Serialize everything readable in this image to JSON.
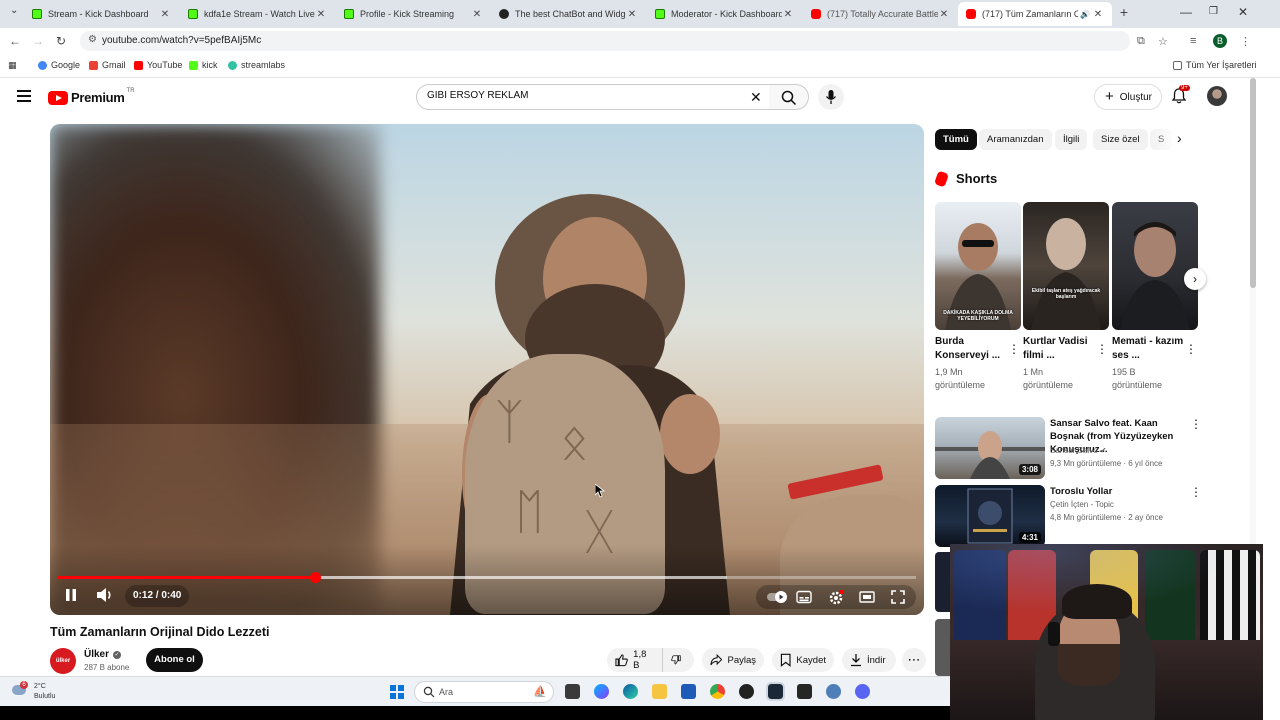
{
  "browser": {
    "tabs": [
      {
        "title": "Stream - Kick Dashboard",
        "favicon": "kick"
      },
      {
        "title": "kdfa1e Stream - Watch Live on",
        "favicon": "kick"
      },
      {
        "title": "Profile - Kick Streaming",
        "favicon": "kick"
      },
      {
        "title": "The best ChatBot and Widgets",
        "favicon": "github"
      },
      {
        "title": "Moderator - Kick Dashboard",
        "favicon": "kick"
      },
      {
        "title": "(717) Totally Accurate Battle Si",
        "favicon": "youtube"
      },
      {
        "title": "(717) Tüm Zamanların Orijin",
        "favicon": "youtube"
      }
    ],
    "url": "youtube.com/watch?v=5pefBAIj5Mc",
    "profile_initial": "B",
    "bookmarks": [
      "Google",
      "Gmail",
      "YouTube",
      "kick",
      "streamlabs"
    ],
    "all_bookmarks": "Tüm Yer İşaretleri"
  },
  "youtube": {
    "logo_text": "Premium",
    "logo_region": "TR",
    "search_query": "GİBİ ERSOY REKLAM",
    "create_label": "Oluştur",
    "notif_count": "9+"
  },
  "player": {
    "time": "0:12 / 0:40",
    "progress_fraction": 0.3,
    "buffer_fraction": 0.78
  },
  "video": {
    "title": "Tüm Zamanların Orijinal Dido Lezzeti",
    "channel": "Ülker",
    "channel_avatar_text": "ülker",
    "subscribers": "287 B abone",
    "subscribe_label": "Abone ol",
    "likes": "1,8 B",
    "share_label": "Paylaş",
    "save_label": "Kaydet",
    "download_label": "İndir"
  },
  "chips": [
    "Tümü",
    "Aramanızdan",
    "İlgili",
    "Size özel",
    "S"
  ],
  "shorts": {
    "heading": "Shorts",
    "items": [
      {
        "title": "Burda Konserveyi ...",
        "views": "1,9 Mn görüntüleme",
        "caption": "DAKİKADA KAŞIKLA DOLMA YEYEBİLİYORUM"
      },
      {
        "title": "Kurtlar Vadisi filmi ...",
        "views": "1 Mn görüntüleme",
        "caption": "Ekibil taşları ateş yağdıracak başlarım"
      },
      {
        "title": "Memati - kazım ses ...",
        "views": "195 B görüntüleme",
        "caption": ""
      }
    ]
  },
  "recommended": [
    {
      "title": "Sansar Salvo feat. Kaan Boşnak (from Yüzyüzeyken Konuşuruz...",
      "channel": "Sansar Salvo",
      "meta": "9,3 Mn görüntüleme · 6 yıl önce",
      "duration": "3:08"
    },
    {
      "title": "Toroslu Yollar",
      "channel": "Çetin İçten - Topic",
      "meta": "4,8 Mn görüntüleme · 2 ay önce",
      "duration": "4:31"
    }
  ],
  "taskbar": {
    "temperature": "2°C",
    "condition": "Bulutlu",
    "alert_count": "6",
    "search_placeholder": "Ara"
  }
}
